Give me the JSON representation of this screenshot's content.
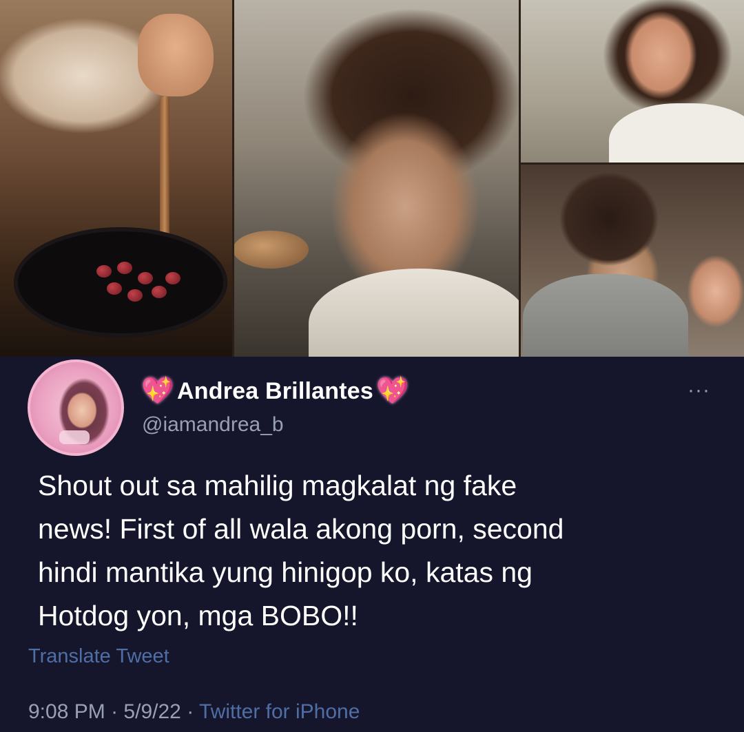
{
  "tweet": {
    "display_name": "Andrea Brillantes",
    "name_emoji": "💖",
    "handle": "@iamandrea_b",
    "more_label": "···",
    "text_lines": [
      "Shout out sa mahilig magkalat ng fake",
      "news! First of all wala akong porn, second",
      "hindi mantika yung hinigop ko, katas ng",
      "Hotdog yon, mga BOBO!!"
    ],
    "translate_label": "Translate Tweet",
    "time": "9:08 PM",
    "date": "5/9/22",
    "separator": "·",
    "source": "Twitter for iPhone"
  },
  "colors": {
    "background": "#15162c",
    "link": "#4f6ea6",
    "muted": "#9aa0b3",
    "heart": "#f24fb0"
  },
  "icons": [
    "sparkling-heart-icon",
    "more-options-icon"
  ]
}
